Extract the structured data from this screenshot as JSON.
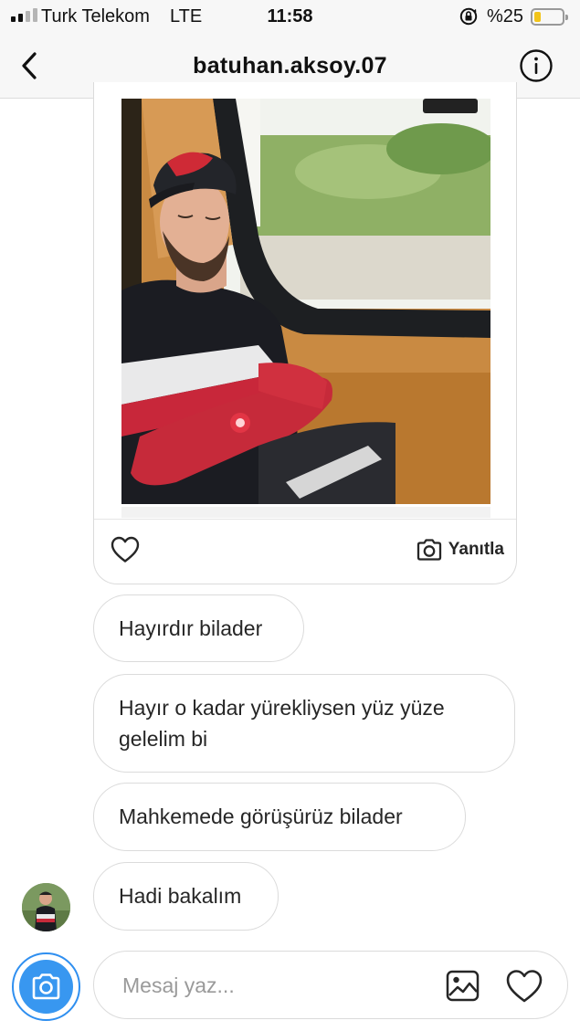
{
  "status_bar": {
    "carrier": "Turk Telekom",
    "network": "LTE",
    "time": "11:58",
    "battery_percent": "%25",
    "battery_level": 0.25,
    "battery_color": "#f2c419"
  },
  "nav": {
    "back_icon": "chevron-left-icon",
    "username": "batuhan.aksoy.07",
    "info_icon": "info-icon"
  },
  "shared_photo": {
    "description_icon": "photo-of-sleeping-man-on-bus",
    "like_icon": "heart-icon",
    "reply_icon": "camera-icon",
    "reply_label": "Yanıtla"
  },
  "messages": [
    {
      "text": "Hayırdır bilader"
    },
    {
      "text": "Hayır o kadar yürekliysen yüz yüze gelelim bi"
    },
    {
      "text": "Mahkemede görüşürüz bilader"
    },
    {
      "text": "Hadi bakalım"
    }
  ],
  "composer": {
    "camera_icon": "camera-icon",
    "placeholder": "Mesaj yaz...",
    "gallery_icon": "gallery-icon",
    "like_icon": "heart-icon",
    "accent_color": "#3897f0"
  }
}
